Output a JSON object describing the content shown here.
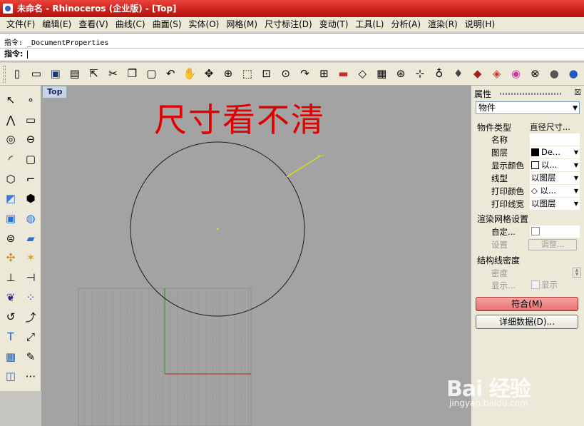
{
  "window": {
    "title": "未命名 - Rhinoceros (企业版) - [Top]"
  },
  "menu": [
    "文件(F)",
    "编辑(E)",
    "查看(V)",
    "曲线(C)",
    "曲面(S)",
    "实体(O)",
    "网格(M)",
    "尺寸标注(D)",
    "变动(T)",
    "工具(L)",
    "分析(A)",
    "渲染(R)",
    "说明(H)"
  ],
  "command": {
    "history": "指令: _DocumentProperties",
    "prompt": "指令:",
    "value": ""
  },
  "toolbar": {
    "icons": [
      "new-file-icon",
      "open-folder-icon",
      "save-icon",
      "print-icon",
      "import-icon",
      "cut-icon",
      "copy-icon",
      "paste-icon",
      "undo-icon",
      "pan-hand-icon",
      "rotate-view-icon",
      "zoom-icon",
      "zoom-window-icon",
      "zoom-extents-icon",
      "zoom-selected-icon",
      "redo-view-icon",
      "four-viewports-icon",
      "car-icon",
      "plane-icon",
      "grid-snap-icon",
      "object-snap-icon",
      "cplane-icon",
      "light-bulb-icon",
      "pin-icon",
      "ghosted-icon",
      "shaded-icon",
      "color-wheel-icon",
      "wireframe-sphere-icon",
      "render-sphere-icon",
      "blue-sphere-icon"
    ]
  },
  "lefttools": {
    "col1": [
      "select-arrow-icon",
      "polyline-icon",
      "circle-icon",
      "arc-icon",
      "polygon-icon",
      "freeform-surface-icon",
      "box-solid-icon",
      "cylinder-solid-icon",
      "transform-icon",
      "dimension-icon",
      "boolean-icon",
      "curve-tools-icon",
      "text-icon",
      "array-icon",
      "block-icon"
    ],
    "col2": [
      "point-icon",
      "rectangle-icon",
      "ellipse-icon",
      "rectangle-curve-icon",
      "fillet-icon",
      "surface-edit-icon",
      "sphere-solid-icon",
      "surface-patch-icon",
      "explode-icon",
      "trim-icon",
      "points-icon",
      "rebuild-icon",
      "scale-icon",
      "move-edit-icon",
      "more-icon"
    ]
  },
  "viewport": {
    "label": "Top",
    "annotation": "尺寸看不清"
  },
  "panel": {
    "title": "属性",
    "close": "☒",
    "object_type": "物件",
    "section_object": "物件类型",
    "object_type_value": "直径尺寸...",
    "rows": [
      {
        "key": "名称",
        "value": ""
      },
      {
        "key": "图层",
        "value": "De..."
      },
      {
        "key": "显示颜色",
        "value": "以..."
      },
      {
        "key": "线型",
        "value": "以图层"
      },
      {
        "key": "打印颜色",
        "value": "◇ 以..."
      },
      {
        "key": "打印线宽",
        "value": "以图层"
      }
    ],
    "section_render": "渲染网格设置",
    "custom_label": "自定...",
    "settings_label": "设置",
    "adjust_label": "调整...",
    "section_isocurve": "结构线密度",
    "density_label": "密度",
    "display_label": "显示...",
    "display_check": "显示",
    "match_button": "符合(M)",
    "details_button": "详细数据(D)..."
  },
  "watermark": {
    "brand": "Bai 经验",
    "url": "jingyan.baidu.com"
  },
  "colors": {
    "title_bar": "#c8201a",
    "annotation": "#e00000",
    "dimension_line": "#e8e800",
    "axis_x": "#c0392b",
    "axis_y": "#2e9e2e",
    "match_button": "#e87070"
  }
}
